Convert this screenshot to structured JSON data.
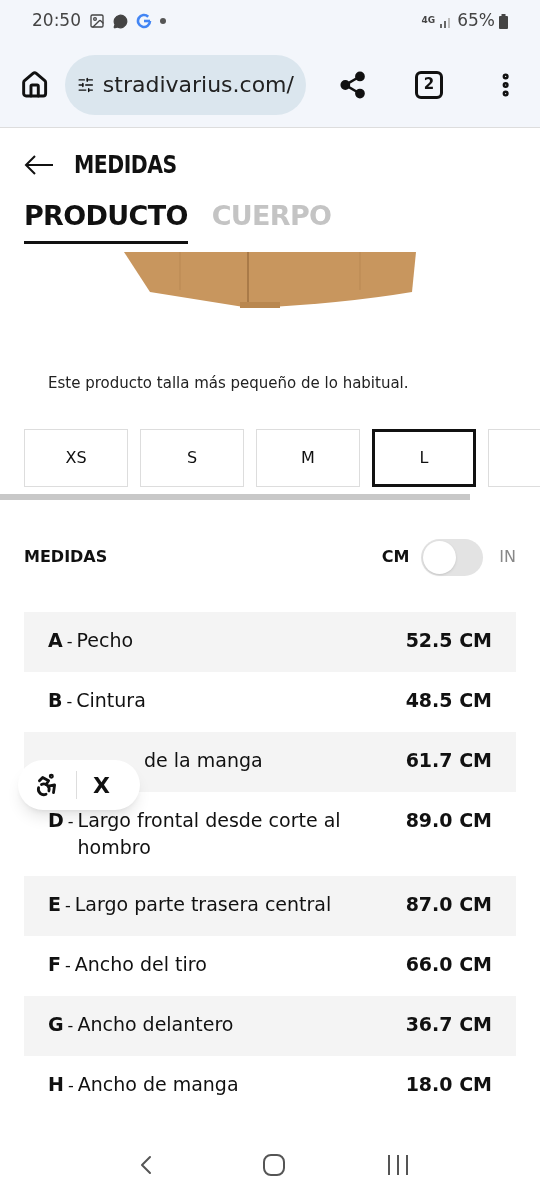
{
  "status_bar": {
    "time": "20:50",
    "network": "4G",
    "battery": "65%"
  },
  "browser": {
    "url": "stradivarius.com/",
    "tab_count": "2"
  },
  "header": {
    "title": "MEDIDAS"
  },
  "tabs": [
    {
      "label": "PRODUCTO",
      "selected": true
    },
    {
      "label": "CUERPO",
      "selected": false
    }
  ],
  "fit_note": "Este producto talla más pequeño de lo habitual.",
  "sizes": [
    {
      "label": "XS",
      "selected": false
    },
    {
      "label": "S",
      "selected": false
    },
    {
      "label": "M",
      "selected": false
    },
    {
      "label": "L",
      "selected": true
    },
    {
      "selected": false
    }
  ],
  "measurements": {
    "title": "MEDIDAS",
    "unit_left": "CM",
    "unit_right": "IN",
    "unit_toggle_on": false,
    "rows": [
      {
        "letter": "A",
        "separator": "-",
        "label": "Pecho",
        "value": "52.5 CM",
        "covered": false
      },
      {
        "letter": "B",
        "separator": "-",
        "label": "Cintura",
        "value": "48.5 CM",
        "covered": false
      },
      {
        "label": "de la manga",
        "value": "61.7 CM",
        "covered": true
      },
      {
        "letter": "D",
        "separator": "-",
        "label": "Largo frontal desde corte al hombro",
        "value": "89.0 CM",
        "covered": false
      },
      {
        "letter": "E",
        "separator": "-",
        "label": "Largo parte trasera central",
        "value": "87.0 CM",
        "covered": false
      },
      {
        "letter": "F",
        "separator": "-",
        "label": "Ancho del tiro",
        "value": "66.0 CM",
        "covered": false
      },
      {
        "letter": "G",
        "separator": "-",
        "label": "Ancho delantero",
        "value": "36.7 CM",
        "covered": false
      },
      {
        "letter": "H",
        "separator": "-",
        "label": "Ancho de manga",
        "value": "18.0 CM",
        "covered": false
      }
    ]
  },
  "accessibility_widget": {
    "close": "X"
  }
}
